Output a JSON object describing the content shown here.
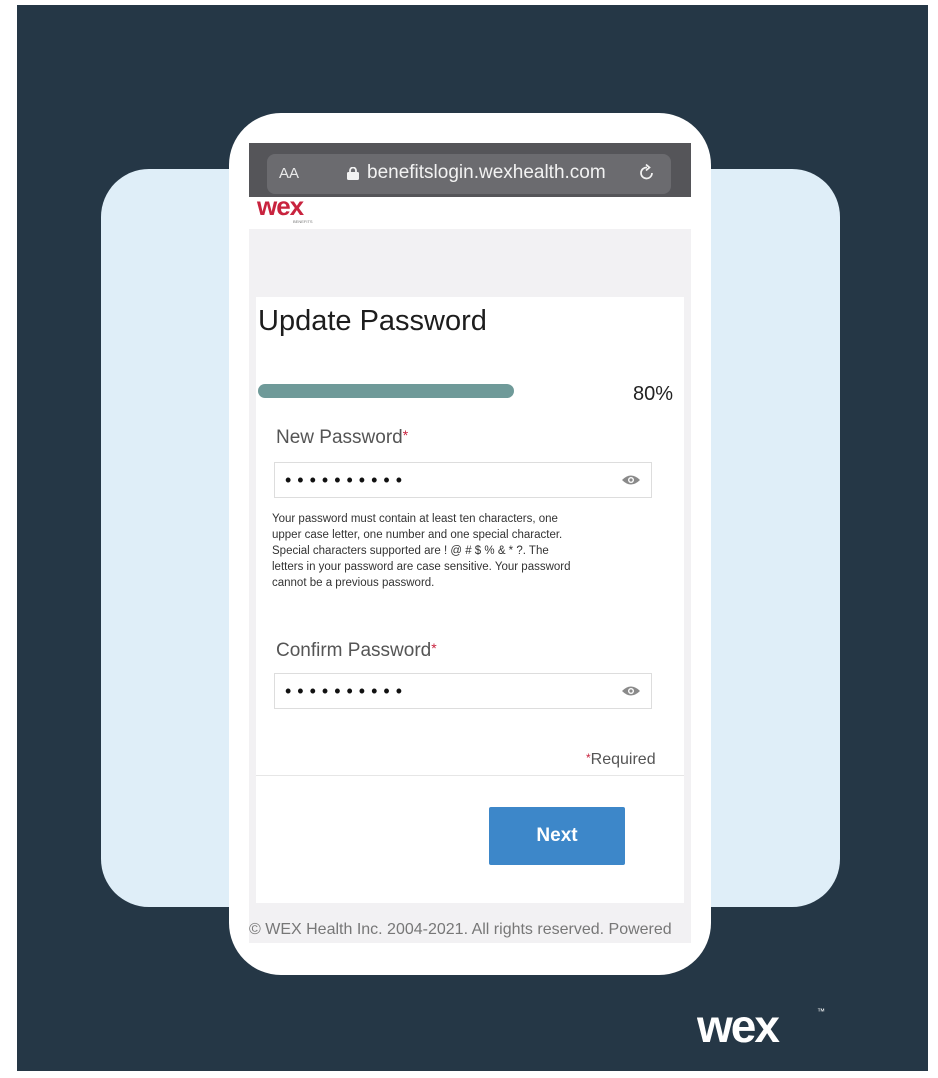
{
  "browser": {
    "text_size_label": "AA",
    "url": "benefitslogin.wexhealth.com",
    "icons": {
      "lock": "lock-icon",
      "reload": "reload-icon"
    }
  },
  "brand": {
    "logo_text": "wex",
    "logo_subtext": "BENEFITS",
    "corner_logo_text": "wex"
  },
  "form": {
    "title": "Update Password",
    "progress_percent": 80,
    "progress_label": "80%",
    "new_password": {
      "label": "New Password",
      "required_mark": "*",
      "value_masked": "••••••••••"
    },
    "help_text": "Your password must contain at least ten characters, one upper case letter, one number and one special character. Special characters supported are ! @ # $ % & * ?. The letters in your password are case sensitive. Your password cannot be a previous password.",
    "confirm_password": {
      "label": "Confirm Password",
      "required_mark": "*",
      "value_masked": "••••••••••"
    },
    "required_mark": "*",
    "required_label": "Required",
    "next_label": "Next"
  },
  "footer": {
    "text": "© WEX Health Inc. 2004-2021. All rights reserved. Powered"
  },
  "colors": {
    "background_dark": "#253746",
    "card_light": "#dfeef8",
    "progress": "#6f9a99",
    "button": "#3d87c9",
    "brand_red": "#c8233e"
  }
}
